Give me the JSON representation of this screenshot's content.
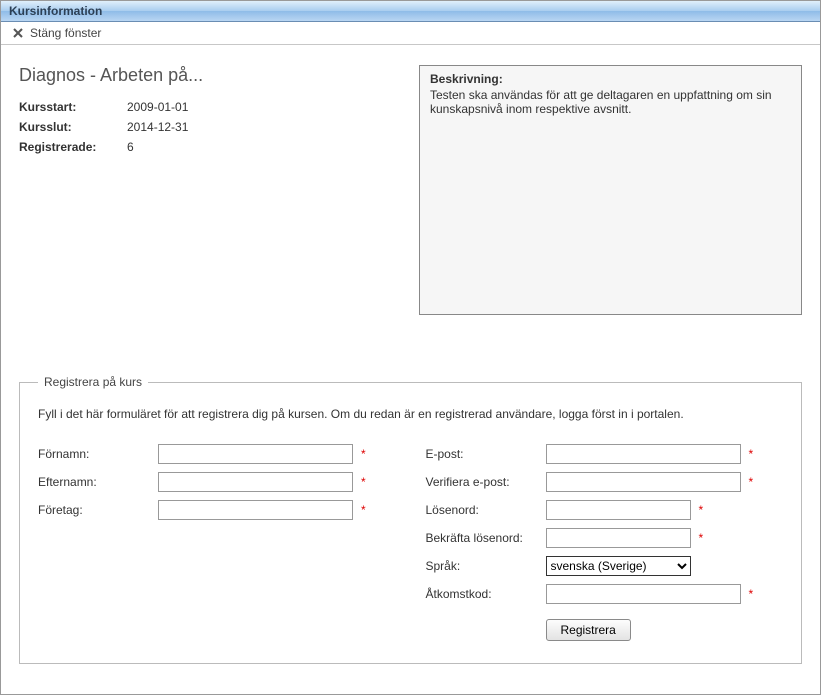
{
  "window": {
    "title": "Kursinformation"
  },
  "toolbar": {
    "close_label": "Stäng fönster"
  },
  "course": {
    "title": "Diagnos - Arbeten på...",
    "meta": {
      "start_label": "Kursstart:",
      "start_value": "2009-01-01",
      "end_label": "Kursslut:",
      "end_value": "2014-12-31",
      "reg_label": "Registrerade:",
      "reg_value": "6"
    },
    "description": {
      "heading": "Beskrivning:",
      "text": "Testen ska användas för att ge deltagaren en uppfattning om sin kunskapsnivå inom respektive avsnitt."
    }
  },
  "form": {
    "legend": "Registrera på kurs",
    "intro": "Fyll i det här formuläret för att registrera dig på kursen. Om du redan är en registrerad användare, logga först in i portalen.",
    "fields": {
      "firstname_label": "Förnamn:",
      "lastname_label": "Efternamn:",
      "company_label": "Företag:",
      "email_label": "E-post:",
      "verify_email_label": "Verifiera e-post:",
      "password_label": "Lösenord:",
      "confirm_password_label": "Bekräfta lösenord:",
      "language_label": "Språk:",
      "language_value": "svenska (Sverige)",
      "accesscode_label": "Åtkomstkod:"
    },
    "required_mark": "*",
    "submit_label": "Registrera"
  }
}
